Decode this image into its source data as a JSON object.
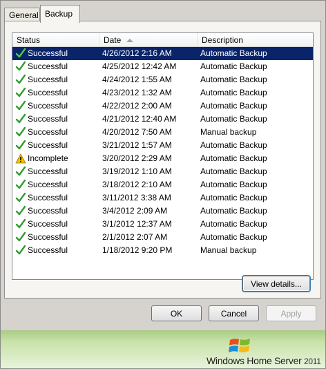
{
  "tabs": [
    {
      "label": "General"
    },
    {
      "label": "Backup"
    }
  ],
  "columns": {
    "status": "Status",
    "date": "Date",
    "description": "Description"
  },
  "rows": [
    {
      "status": "Successful",
      "icon": "check-icon",
      "date": "4/26/2012 2:16 AM",
      "description": "Automatic Backup",
      "selected": true
    },
    {
      "status": "Successful",
      "icon": "check-icon",
      "date": "4/25/2012 12:42 AM",
      "description": "Automatic Backup"
    },
    {
      "status": "Successful",
      "icon": "check-icon",
      "date": "4/24/2012 1:55 AM",
      "description": "Automatic Backup"
    },
    {
      "status": "Successful",
      "icon": "check-icon",
      "date": "4/23/2012 1:32 AM",
      "description": "Automatic Backup"
    },
    {
      "status": "Successful",
      "icon": "check-icon",
      "date": "4/22/2012 2:00 AM",
      "description": "Automatic Backup"
    },
    {
      "status": "Successful",
      "icon": "check-icon",
      "date": "4/21/2012 12:40 AM",
      "description": "Automatic Backup"
    },
    {
      "status": "Successful",
      "icon": "check-icon",
      "date": "4/20/2012 7:50 AM",
      "description": "Manual backup"
    },
    {
      "status": "Successful",
      "icon": "check-icon",
      "date": "3/21/2012 1:57 AM",
      "description": "Automatic Backup"
    },
    {
      "status": "Incomplete",
      "icon": "warning-icon",
      "date": "3/20/2012 2:29 AM",
      "description": "Automatic Backup"
    },
    {
      "status": "Successful",
      "icon": "check-icon",
      "date": "3/19/2012 1:10 AM",
      "description": "Automatic Backup"
    },
    {
      "status": "Successful",
      "icon": "check-icon",
      "date": "3/18/2012 2:10 AM",
      "description": "Automatic Backup"
    },
    {
      "status": "Successful",
      "icon": "check-icon",
      "date": "3/11/2012 3:38 AM",
      "description": "Automatic Backup"
    },
    {
      "status": "Successful",
      "icon": "check-icon",
      "date": "3/4/2012 2:09 AM",
      "description": "Automatic Backup"
    },
    {
      "status": "Successful",
      "icon": "check-icon",
      "date": "3/1/2012 12:37 AM",
      "description": "Automatic Backup"
    },
    {
      "status": "Successful",
      "icon": "check-icon",
      "date": "2/1/2012 2:07 AM",
      "description": "Automatic Backup"
    },
    {
      "status": "Successful",
      "icon": "check-icon",
      "date": "1/18/2012 9:20 PM",
      "description": "Manual backup"
    }
  ],
  "buttons": {
    "view_details": "View details...",
    "ok": "OK",
    "cancel": "Cancel",
    "apply": "Apply"
  },
  "branding": {
    "name": "Windows Home Server",
    "year": "2011"
  },
  "colors": {
    "check": "#2e9e2e",
    "warning": "#f2c200",
    "selection": "#0a246a"
  }
}
